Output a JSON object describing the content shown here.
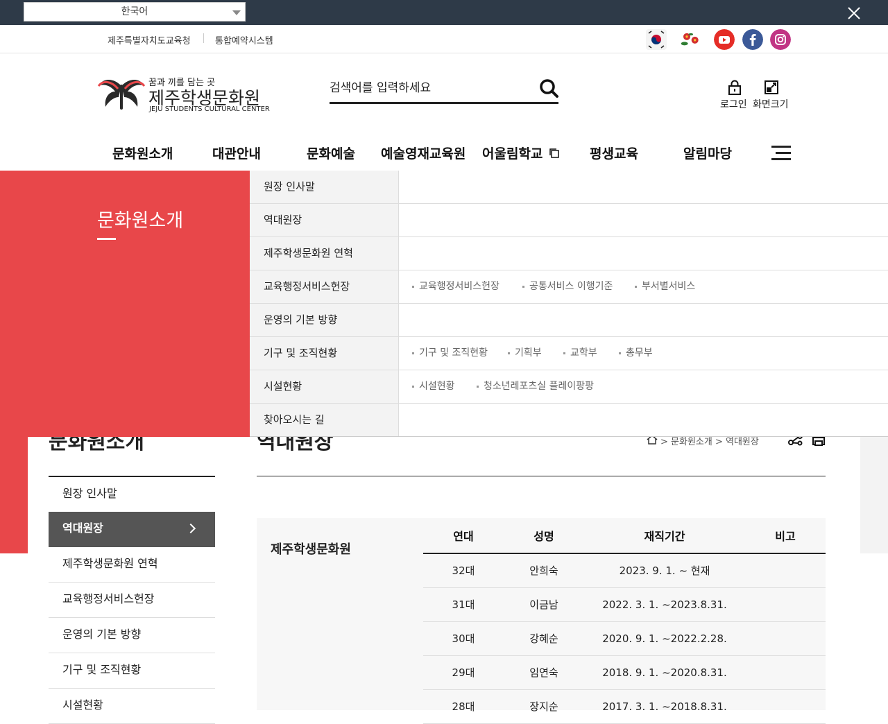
{
  "translate_bar": {
    "language": "한국어"
  },
  "top_links": [
    "제주특별자치도교육청",
    "통합예약시스템"
  ],
  "social": [
    {
      "icon": "korea-flag-icon",
      "color": "#ffffff"
    },
    {
      "icon": "camellia-icon",
      "color": "#d32f2f"
    },
    {
      "icon": "youtube-icon",
      "color": "#e52d27"
    },
    {
      "icon": "facebook-icon",
      "color": "#3b5998"
    },
    {
      "icon": "instagram-icon",
      "color": "#c13584"
    }
  ],
  "logo": {
    "tagline": "꿈과 끼를 담는 곳",
    "name": "제주학생문화원",
    "english": "JEJU STUDENTS CULTURAL CENTER"
  },
  "search": {
    "placeholder": "검색어를 입력하세요"
  },
  "utility": {
    "login": "로그인",
    "zoom": "화면크기"
  },
  "gnb": [
    "문화원소개",
    "대관안내",
    "문화예술",
    "예술영재교육원",
    "어울림학교",
    "평생교육",
    "알림마당"
  ],
  "mega_menu": {
    "title": "문화원소개",
    "rows": [
      {
        "label": "원장 인사말",
        "subs": []
      },
      {
        "label": "역대원장",
        "subs": []
      },
      {
        "label": "제주학생문화원 연혁",
        "subs": []
      },
      {
        "label": "교육행정서비스헌장",
        "subs": [
          "교육행정서비스헌장",
          "공통서비스 이행기준",
          "부서별서비스"
        ]
      },
      {
        "label": "운영의 기본 방향",
        "subs": []
      },
      {
        "label": "기구 및 조직현황",
        "subs": [
          "기구 및 조직현황",
          "기획부",
          "교학부",
          "총무부"
        ]
      },
      {
        "label": "시설현황",
        "subs": [
          "시설현황",
          "청소년레포츠실 플레이팡팡"
        ]
      },
      {
        "label": "찾아오시는 길",
        "subs": []
      }
    ]
  },
  "lnb": {
    "title": "문화원소개",
    "items": [
      "원장 인사말",
      "역대원장",
      "제주학생문화원 연혁",
      "교육행정서비스헌장",
      "운영의 기본 방향",
      "기구 및 조직현황",
      "시설현황"
    ],
    "active_index": 1
  },
  "page": {
    "title": "역대원장",
    "breadcrumb": "> 문화원소개 > 역대원장"
  },
  "history_table": {
    "org": "제주학생문화원",
    "headers": [
      "연대",
      "성명",
      "재직기간",
      "비고"
    ],
    "rows": [
      [
        "32대",
        "안희숙",
        "2023. 9. 1. ~ 현재",
        ""
      ],
      [
        "31대",
        "이금남",
        "2022. 3. 1. ~2023.8.31.",
        ""
      ],
      [
        "30대",
        "강혜순",
        "2020. 9. 1. ~2022.2.28.",
        ""
      ],
      [
        "29대",
        "임연숙",
        "2018. 9. 1. ~2020.8.31.",
        ""
      ],
      [
        "28대",
        "장지순",
        "2017. 3. 1. ~2018.8.31.",
        ""
      ]
    ]
  }
}
